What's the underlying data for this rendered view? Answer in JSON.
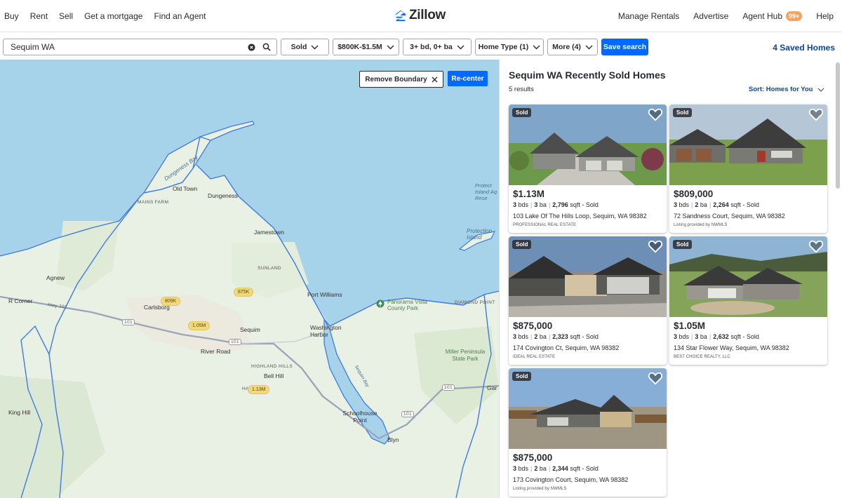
{
  "nav": {
    "left": [
      "Buy",
      "Rent",
      "Sell",
      "Get a mortgage",
      "Find an Agent"
    ],
    "logo": "Zillow",
    "manage_rentals": "Manage Rentals",
    "advertise": "Advertise",
    "agent_hub": "Agent Hub",
    "agent_hub_badge": "99+",
    "help": "Help"
  },
  "search": {
    "value": "Sequim WA",
    "filters": {
      "status": "Sold",
      "price": "$800K-$1.5M",
      "beds_baths": "3+ bd, 0+ ba",
      "home_type": "Home Type (1)",
      "more": "More (4)"
    },
    "save_search": "Save search",
    "saved_homes": "4 Saved Homes"
  },
  "map": {
    "remove_boundary": "Remove Boundary",
    "recenter": "Re-center",
    "labels": {
      "old_town": "Old Town",
      "dungeness": "Dungeness",
      "mains_farm": "MAINS FARM",
      "jamestown": "Jamestown",
      "sunland": "SUNLAND",
      "agnew": "Agnew",
      "carlsborg": "Carlsborg",
      "r_corner": "R Corner",
      "hwy101": "Hwy 101",
      "sequim": "Sequim",
      "river_road": "River Road",
      "port_williams": "Port Williams",
      "washington_harbor": "Washington Harbor",
      "highland_hills": "HIGHLAND HILLS",
      "bell_hill": "Bell Hill",
      "ha_valley": "HA           LEY",
      "king_hill": "King Hill",
      "schoolhouse_point": "Schoolhouse Point",
      "blyn": "Blyn",
      "gardiner": "Gar",
      "panorama_vista": "Panorama Vista County Park",
      "diamond_point": "DIAMOND POINT",
      "miller_peninsula": "Miller Peninsula State Park",
      "protection_island": "Protection Island",
      "protection_island_refuge": "Protect Island Aq Rese",
      "dungeness_bay": "Dungeness Bay",
      "sequim_bay": "Sequim Bay",
      "route101a": "101",
      "route101b": "101",
      "route101c": "101",
      "route101d": "101"
    },
    "price_pins": [
      "809K",
      "875K",
      "1.05M",
      "1.13M"
    ]
  },
  "results": {
    "title": "Sequim WA Recently Sold Homes",
    "count": "5 results",
    "sort": "Sort: Homes for You",
    "listings": [
      {
        "tag": "Sold",
        "price": "$1.13M",
        "beds": "3",
        "baths": "3",
        "sqft": "2,796",
        "status": "Sold",
        "address": "103 Lake Of The Hills Loop, Sequim, WA 98382",
        "broker": "PROFESSIONAL REAL ESTATE"
      },
      {
        "tag": "Sold",
        "price": "$809,000",
        "beds": "3",
        "baths": "2",
        "sqft": "2,264",
        "status": "Sold",
        "address": "72 Sandness Court, Sequim, WA 98382",
        "broker": "Listing provided by NWMLS"
      },
      {
        "tag": "Sold",
        "price": "$875,000",
        "beds": "3",
        "baths": "2",
        "sqft": "2,323",
        "status": "Sold",
        "address": "174 Covington Ct, Sequim, WA 98382",
        "broker": "IDEAL REAL ESTATE"
      },
      {
        "tag": "Sold",
        "price": "$1.05M",
        "beds": "3",
        "baths": "3",
        "sqft": "2,632",
        "status": "Sold",
        "address": "134 Star Flower Way, Sequim, WA 98382",
        "broker": "BEST CHOICE REALTY, LLC"
      },
      {
        "tag": "Sold",
        "price": "$875,000",
        "beds": "3",
        "baths": "2",
        "sqft": "2,344",
        "status": "Sold",
        "address": "173 Covington Court, Sequim, WA 98382",
        "broker": "Listing provided by NWMLS"
      }
    ],
    "units": {
      "bds": "bds",
      "ba": "ba",
      "sqft": "sqft -"
    }
  },
  "colors": {
    "brand_blue": "#006aff",
    "link_blue": "#0d4599",
    "water": "#a7d3ea",
    "land": "#e9f1e4",
    "boundary": "#3f7be0",
    "price_pin": "#f1d87a"
  }
}
